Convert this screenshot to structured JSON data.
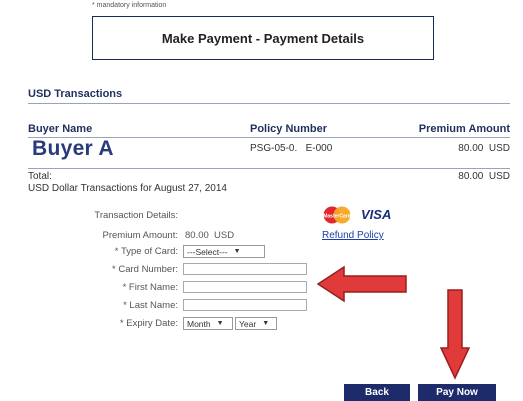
{
  "header": {
    "mandatory_note": "* mandatory information",
    "title": "Make Payment - Payment Details"
  },
  "transactions": {
    "section_title": "USD Transactions",
    "columns": [
      "Buyer Name",
      "Policy Number",
      "Premium Amount"
    ],
    "rows": [
      {
        "buyer": "Buyer A",
        "policy": "PSG-05-0.   E-000",
        "amount": "80.00  USD"
      }
    ],
    "total_label": "Total:",
    "total_amount": "80.00  USD",
    "subtitle": "USD Dollar Transactions for August 27, 2014"
  },
  "details": {
    "heading": "Transaction Details:",
    "premium_label": "Premium Amount:",
    "premium_value": "80.00  USD",
    "card_type_label": "* Type of Card:",
    "card_type_value": "---Select---",
    "card_number_label": "* Card Number:",
    "first_name_label": "* First Name:",
    "last_name_label": "* Last Name:",
    "expiry_label": "* Expiry Date:",
    "expiry_month": "Month",
    "expiry_year": "Year",
    "visa_text": "VISA",
    "mastercard_text": "MasterCard",
    "refund_link": "Refund Policy"
  },
  "actions": {
    "back_label": "Back",
    "pay_label": "Pay Now"
  },
  "colors": {
    "navy": "#1e2b6b",
    "arrow_red": "#e03a3a",
    "link_blue": "#1a3fa8"
  }
}
